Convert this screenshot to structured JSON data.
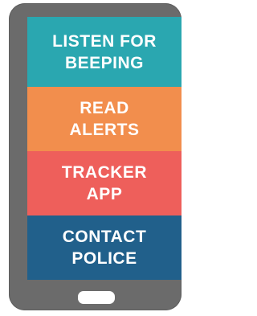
{
  "panels": [
    {
      "label": "LISTEN FOR\nBEEPING",
      "color": "#2aa7b0"
    },
    {
      "label": "READ\nALERTS",
      "color": "#f28e4d"
    },
    {
      "label": "TRACKER\nAPP",
      "color": "#ee5f5b"
    },
    {
      "label": "CONTACT\nPOLICE",
      "color": "#21608b"
    }
  ],
  "phone": {
    "body_color": "#6b6b6b",
    "home_button_color": "#ffffff"
  }
}
